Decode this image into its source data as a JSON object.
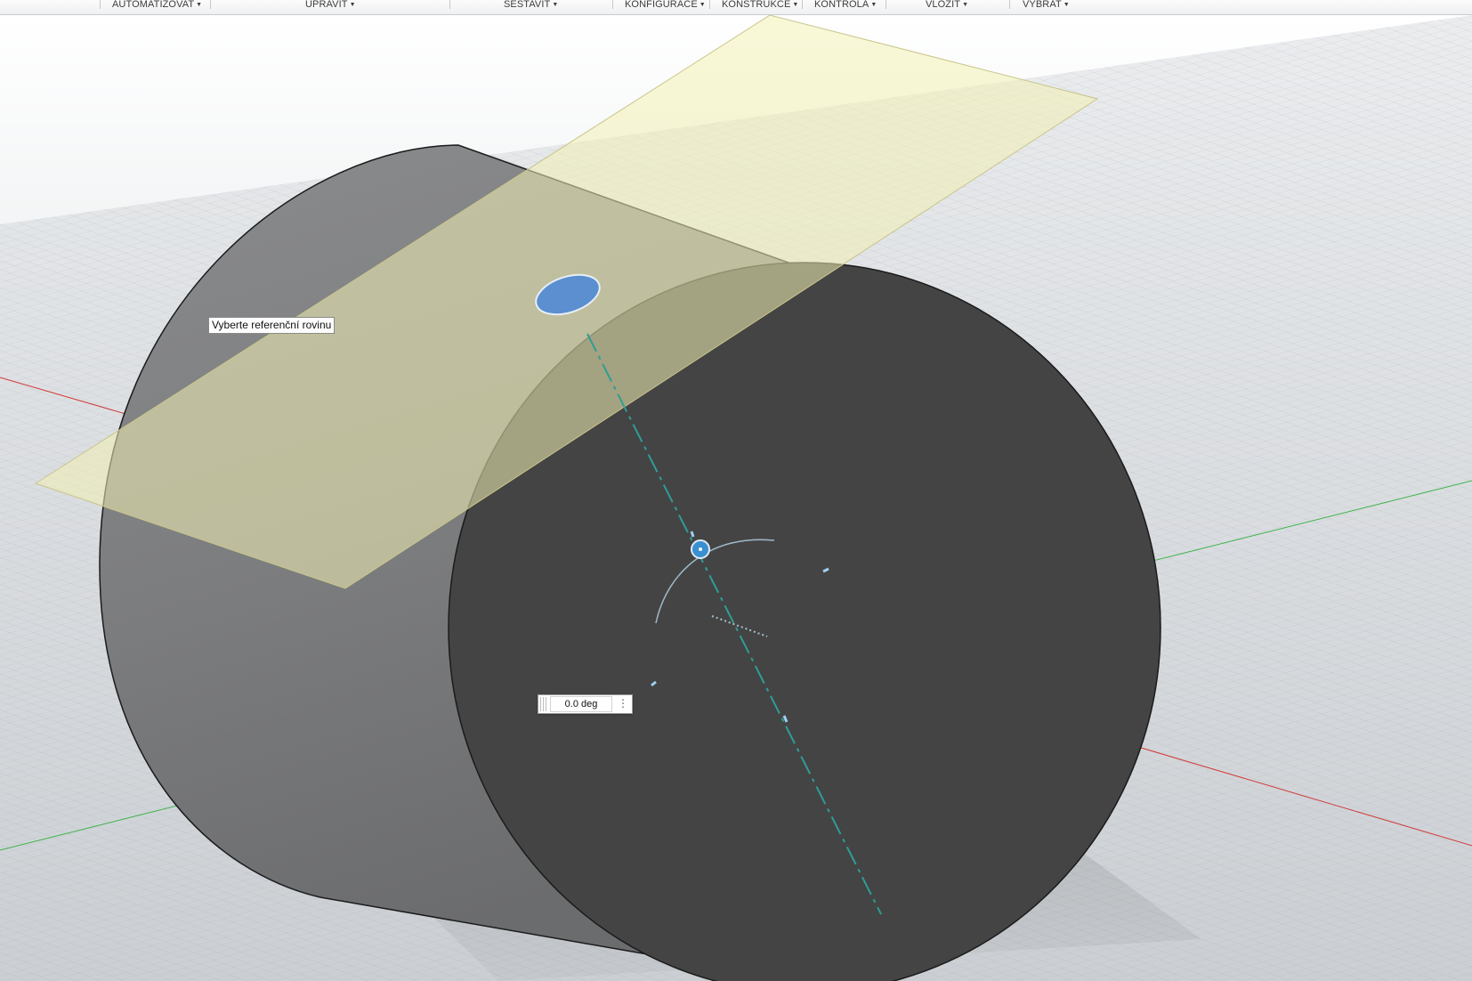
{
  "toolbar": {
    "menus": [
      {
        "label": "AUTOMATIZOVAT"
      },
      {
        "label": "UPRAVIT"
      },
      {
        "label": "SESTAVIT"
      },
      {
        "label": "KONFIGURACE"
      },
      {
        "label": "KONSTRUKCE"
      },
      {
        "label": "KONTROLA"
      },
      {
        "label": "VLOŽIT"
      },
      {
        "label": "VYBRAT"
      }
    ]
  },
  "viewport": {
    "tooltip": "Vyberte referenční rovinu",
    "angle_input": {
      "value": "0.0 deg"
    }
  },
  "colors": {
    "construction_plane": "#f2f0b4",
    "cylinder_front_face": "#444444",
    "manipulator_accent": "#3a8fd0",
    "axis_red": "#d23b3b",
    "axis_green": "#3cb34a"
  },
  "icons": {
    "menu_caret": "caret-down-icon",
    "angle_options": "more-options-icon",
    "angle_grip": "drag-handle-icon"
  }
}
